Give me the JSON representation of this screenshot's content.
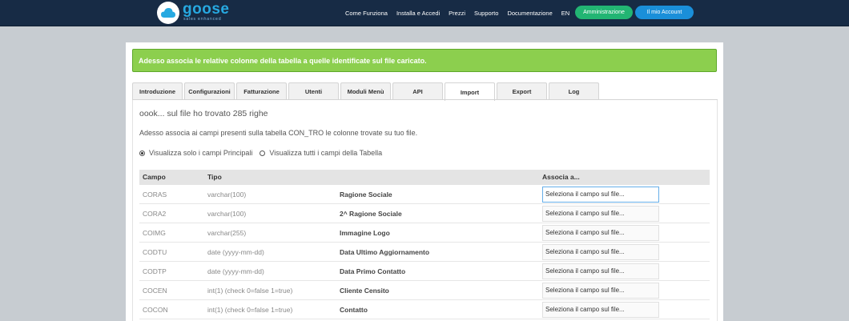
{
  "brand": {
    "name": "goose",
    "tagline": "sales enhanced"
  },
  "nav": {
    "items": [
      "Come Funziona",
      "Installa e Accedi",
      "Prezzi",
      "Supporto",
      "Documentazione",
      "EN"
    ],
    "admin_button": "Amministrazione",
    "account_button": "Il mio Account",
    "admin_color": "#22b573",
    "account_color": "#1a8fd9"
  },
  "alert": {
    "text": "Adesso associa le relative colonne della tabella a quelle identificate sul file caricato.",
    "color": "#8ccf4e"
  },
  "tabs": [
    {
      "label": "Introduzione",
      "active": false
    },
    {
      "label": "Configurazioni",
      "active": false
    },
    {
      "label": "Fatturazione",
      "active": false
    },
    {
      "label": "Utenti",
      "active": false
    },
    {
      "label": "Moduli Menù",
      "active": false
    },
    {
      "label": "API",
      "active": false
    },
    {
      "label": "Import",
      "active": true
    },
    {
      "label": "Export",
      "active": false
    },
    {
      "label": "Log",
      "active": false
    }
  ],
  "import": {
    "found_text": "oook... sul file ho trovato 285 righe",
    "instruction": "Adesso associa ai campi presenti sulla tabella CON_TRO le colonne trovate su tuo file.",
    "radio_main": "Visualizza solo i campi Principali",
    "radio_all": "Visualizza tutti i campi della Tabella",
    "radio_selected": "main"
  },
  "table": {
    "headers": {
      "campo": "Campo",
      "tipo": "Tipo",
      "associa": "Associa a..."
    },
    "select_placeholder": "Seleziona il campo sul file...",
    "rows": [
      {
        "campo": "CORAS",
        "tipo": "varchar(100)",
        "desc": "Ragione Sociale"
      },
      {
        "campo": "CORA2",
        "tipo": "varchar(100)",
        "desc": "2^ Ragione Sociale"
      },
      {
        "campo": "COIMG",
        "tipo": "varchar(255)",
        "desc": "Immagine Logo"
      },
      {
        "campo": "CODTU",
        "tipo": "date (yyyy-mm-dd)",
        "desc": "Data Ultimo Aggiornamento"
      },
      {
        "campo": "CODTP",
        "tipo": "date (yyyy-mm-dd)",
        "desc": "Data Primo Contatto"
      },
      {
        "campo": "COCEN",
        "tipo": "int(1) (check 0=false 1=true)",
        "desc": "Cliente Censito"
      },
      {
        "campo": "COCON",
        "tipo": "int(1) (check 0=false 1=true)",
        "desc": "Contatto"
      }
    ]
  }
}
